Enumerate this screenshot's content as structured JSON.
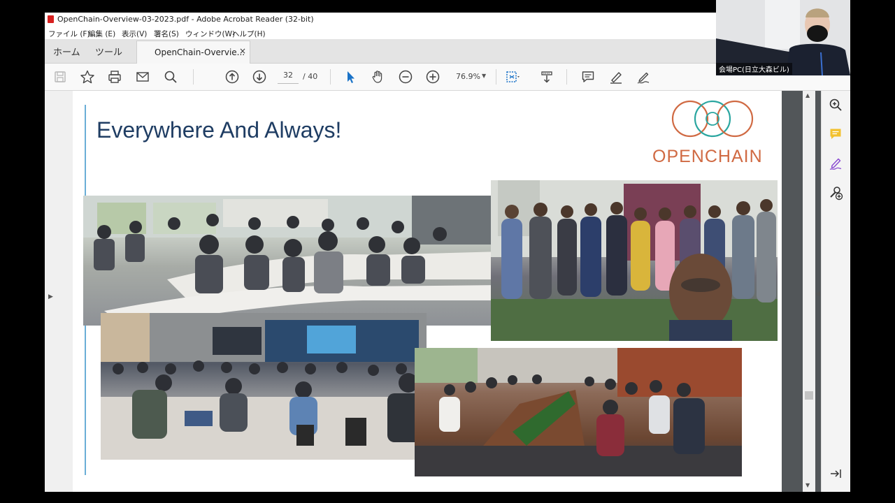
{
  "window": {
    "title": "OpenChain-Overview-03-2023.pdf - Adobe Acrobat Reader (32-bit)",
    "menu": [
      "ファイル (F)",
      "編集 (E)",
      "表示(V)",
      "署名(S)",
      "ウィンドウ(W)",
      "ヘルプ(H)"
    ]
  },
  "tabs": {
    "home": "ホーム",
    "tools": "ツール",
    "document": "OpenChain-Overvie...",
    "close": "×"
  },
  "toolbar": {
    "current_page": "32",
    "page_separator": "/ 40",
    "zoom": "76.9%"
  },
  "slide": {
    "title": "Everywhere And Always!",
    "logo_text": "OPENCHAIN"
  },
  "webcam": {
    "name": "会場PC(日立大森ビル)"
  },
  "colors": {
    "title": "#1f3d63",
    "logo_orange": "#d06a43",
    "logo_teal": "#2aa6a0",
    "accent_rule": "#6aaed6"
  },
  "icons": {
    "save": "save-icon",
    "bookmark": "star-icon",
    "print": "print-icon",
    "email": "mail-icon",
    "search": "magnifier-icon",
    "prev_page": "arrow-up-circle-icon",
    "next_page": "arrow-down-circle-icon",
    "select": "cursor-icon",
    "hand": "hand-icon",
    "zoom_out": "minus-circle-icon",
    "zoom_in": "plus-circle-icon"
  }
}
